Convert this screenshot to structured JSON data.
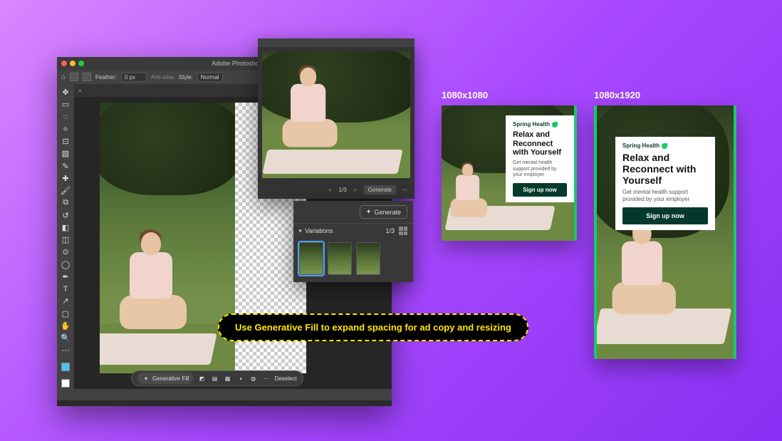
{
  "photoshop": {
    "app_title": "Adobe Photoshop",
    "options": {
      "feather_label": "Feather:",
      "feather_value": "0 px",
      "antialias_label": "Anti-alias",
      "style_label": "Style:",
      "style_value": "Normal"
    },
    "context_toolbar": {
      "generative_fill": "Generative Fill",
      "deselect": "Deselect"
    },
    "variations_panel": {
      "generate": "Generate",
      "variations_label": "Variations",
      "count": "1/3"
    },
    "status": ""
  },
  "callout": {
    "text": "Use Generative Fill to expand spacing for ad copy and resizing"
  },
  "ads": {
    "square_label": "1080x1080",
    "story_label": "1080x1920",
    "brand": "Spring Health",
    "headline": "Relax and Reconnect with Yourself",
    "subcopy": "Get mental health support provided by your employer",
    "cta": "Sign up now"
  }
}
